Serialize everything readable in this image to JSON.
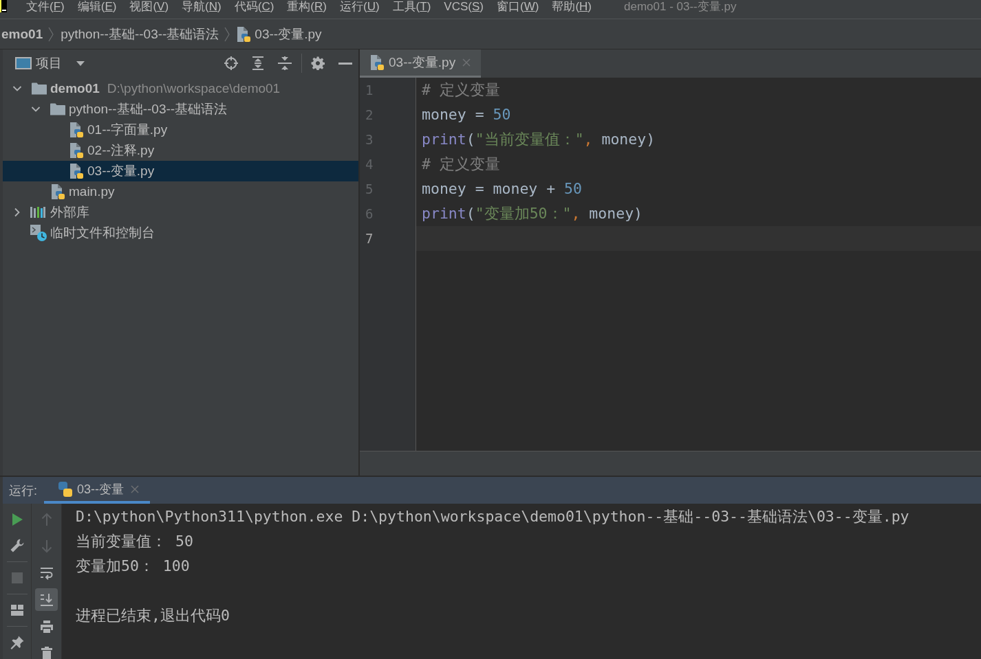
{
  "menu_bar": {
    "items": [
      {
        "prefix": "文件(",
        "mnemonic": "F",
        "suffix": ")"
      },
      {
        "prefix": "编辑(",
        "mnemonic": "E",
        "suffix": ")"
      },
      {
        "prefix": "视图(",
        "mnemonic": "V",
        "suffix": ")"
      },
      {
        "prefix": "导航(",
        "mnemonic": "N",
        "suffix": ")"
      },
      {
        "prefix": "代码(",
        "mnemonic": "C",
        "suffix": ")"
      },
      {
        "prefix": "重构(",
        "mnemonic": "R",
        "suffix": ")"
      },
      {
        "prefix": "运行(",
        "mnemonic": "U",
        "suffix": ")"
      },
      {
        "prefix": "工具(",
        "mnemonic": "T",
        "suffix": ")"
      },
      {
        "prefix": "VCS(",
        "mnemonic": "S",
        "suffix": ")"
      },
      {
        "prefix": "窗口(",
        "mnemonic": "W",
        "suffix": ")"
      },
      {
        "prefix": "帮助(",
        "mnemonic": "H",
        "suffix": ")"
      }
    ],
    "title": "demo01 - 03--变量.py"
  },
  "breadcrumbs": [
    {
      "kind": "project",
      "label": "emo01"
    },
    {
      "kind": "folder",
      "label": "python--基础--03--基础语法"
    },
    {
      "kind": "python-file",
      "label": "03--变量.py"
    }
  ],
  "project_panel": {
    "title": "项目",
    "tree": [
      {
        "kind": "project",
        "label": "demo01",
        "detail": "D:\\python\\workspace\\demo01",
        "expanded": true,
        "selected": false,
        "children": [
          {
            "kind": "folder",
            "label": "python--基础--03--基础语法",
            "expanded": true,
            "selected": false,
            "children": [
              {
                "kind": "python-file",
                "label": "01--字面量.py",
                "selected": false
              },
              {
                "kind": "python-file",
                "label": "02--注释.py",
                "selected": false
              },
              {
                "kind": "python-file",
                "label": "03--变量.py",
                "selected": true
              }
            ]
          },
          {
            "kind": "python-file",
            "label": "main.py",
            "selected": false
          }
        ]
      },
      {
        "kind": "library",
        "label": "外部库",
        "expanded": false,
        "selected": false
      },
      {
        "kind": "scratches",
        "label": "临时文件和控制台",
        "selected": false
      }
    ]
  },
  "editor": {
    "tabs": [
      {
        "label": "03--变量.py",
        "selected": true
      }
    ],
    "lines": [
      {
        "number": "1",
        "current": false,
        "tokens": [
          {
            "kind": "comment",
            "text": "# 定义变量"
          }
        ]
      },
      {
        "number": "2",
        "current": false,
        "tokens": [
          {
            "kind": "plain",
            "text": "money = "
          },
          {
            "kind": "number",
            "text": "50"
          }
        ]
      },
      {
        "number": "3",
        "current": false,
        "tokens": [
          {
            "kind": "builtin",
            "text": "print"
          },
          {
            "kind": "plain",
            "text": "("
          },
          {
            "kind": "string",
            "text": "\"当前变量值：\""
          },
          {
            "kind": "comma",
            "text": ","
          },
          {
            "kind": "plain",
            "text": " money)"
          }
        ]
      },
      {
        "number": "4",
        "current": false,
        "tokens": [
          {
            "kind": "comment",
            "text": "# 定义变量"
          }
        ]
      },
      {
        "number": "5",
        "current": false,
        "tokens": [
          {
            "kind": "plain",
            "text": "money = money + "
          },
          {
            "kind": "number",
            "text": "50"
          }
        ]
      },
      {
        "number": "6",
        "current": false,
        "tokens": [
          {
            "kind": "builtin",
            "text": "print"
          },
          {
            "kind": "plain",
            "text": "("
          },
          {
            "kind": "string",
            "text": "\"变量加50：\""
          },
          {
            "kind": "comma",
            "text": ","
          },
          {
            "kind": "plain",
            "text": " money)"
          }
        ]
      },
      {
        "number": "7",
        "current": true
      }
    ]
  },
  "run_panel": {
    "label": "运行:",
    "tabs": [
      {
        "label": "03--变量",
        "selected": true
      }
    ],
    "main_toolbar": [
      {
        "tools": [
          {
            "kind": "rerun",
            "disabled": false,
            "on": false
          },
          {
            "kind": "wrench",
            "disabled": false,
            "on": false
          }
        ]
      },
      {
        "tools": [
          {
            "kind": "stop",
            "disabled": true,
            "on": false
          }
        ]
      },
      {
        "tools": [
          {
            "kind": "layout",
            "disabled": false,
            "on": false
          }
        ]
      },
      {
        "tools": [
          {
            "kind": "pin",
            "disabled": false,
            "on": false
          }
        ]
      }
    ],
    "console_toolbar": [
      {
        "kind": "up",
        "disabled": true,
        "on": false
      },
      {
        "kind": "down",
        "disabled": true,
        "on": false
      },
      {
        "kind": "softwrap",
        "disabled": false,
        "on": false
      },
      {
        "kind": "autoscroll",
        "disabled": false,
        "on": true
      },
      {
        "kind": "print",
        "disabled": false,
        "on": false
      },
      {
        "kind": "trash",
        "disabled": false,
        "on": false
      }
    ],
    "console": [
      {
        "kind": "command",
        "text": "D:\\python\\Python311\\python.exe D:\\python\\workspace\\demo01\\python--基础--03--基础语法\\03--变量.py"
      },
      {
        "kind": "output",
        "text": "当前变量值： 50"
      },
      {
        "kind": "output",
        "text": "变量加50： 100"
      },
      {
        "kind": "exit",
        "text": "进程已结束,退出代码0"
      }
    ]
  }
}
